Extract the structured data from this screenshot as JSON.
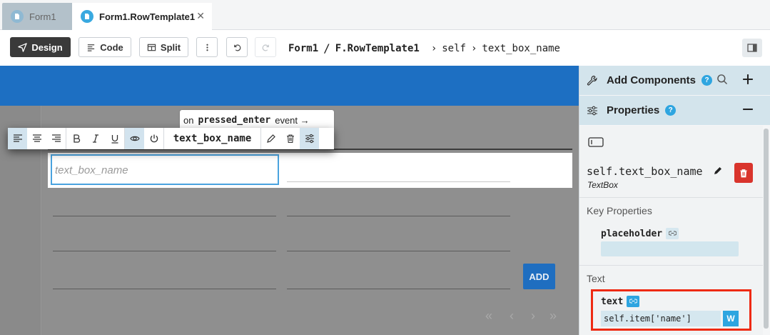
{
  "tabs": [
    {
      "label": "Form1",
      "active": false
    },
    {
      "label": "Form1.RowTemplate1",
      "active": true
    }
  ],
  "toolbar": {
    "design_label": "Design",
    "code_label": "Code",
    "split_label": "Split"
  },
  "breadcrumb": {
    "form": "Form1",
    "template": "F.RowTemplate1",
    "self": "self",
    "component": "text_box_name",
    "slash": "/",
    "chevron": "›"
  },
  "canvas": {
    "placeholder": "text_box_name",
    "add_label": "ADD",
    "pager": [
      "«",
      "‹",
      "›",
      "»"
    ]
  },
  "floating_toolbar": {
    "event_prefix": "on",
    "event_name": "pressed_enter",
    "event_suffix": "event →",
    "component_name": "text_box_name"
  },
  "panel": {
    "add_components": "Add Components",
    "properties": "Properties",
    "help_glyph": "?",
    "component_path": "self.text_box_name",
    "component_type": "TextBox",
    "key_properties": "Key Properties",
    "placeholder_label": "placeholder",
    "text_section": "Text",
    "text_label": "text",
    "text_value": "self.item['name']",
    "w_label": "W"
  },
  "colors": {
    "blue_bar": "#1d6fc2",
    "accent": "#2ea5e0",
    "delete": "#d9342c",
    "highlight": "#ee2a12"
  }
}
